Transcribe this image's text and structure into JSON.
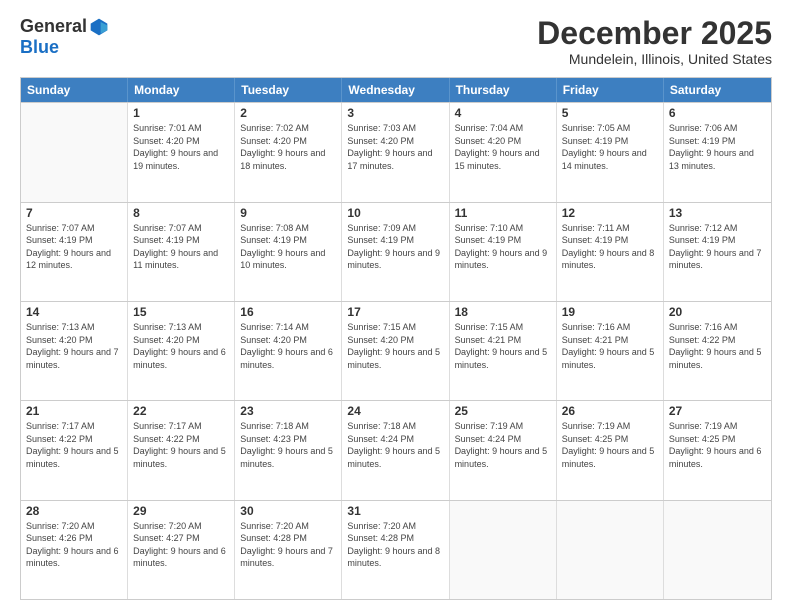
{
  "logo": {
    "general": "General",
    "blue": "Blue"
  },
  "title": "December 2025",
  "location": "Mundelein, Illinois, United States",
  "days": [
    "Sunday",
    "Monday",
    "Tuesday",
    "Wednesday",
    "Thursday",
    "Friday",
    "Saturday"
  ],
  "weeks": [
    [
      {
        "day": "",
        "sunrise": "",
        "sunset": "",
        "daylight": ""
      },
      {
        "day": "1",
        "sunrise": "Sunrise: 7:01 AM",
        "sunset": "Sunset: 4:20 PM",
        "daylight": "Daylight: 9 hours and 19 minutes."
      },
      {
        "day": "2",
        "sunrise": "Sunrise: 7:02 AM",
        "sunset": "Sunset: 4:20 PM",
        "daylight": "Daylight: 9 hours and 18 minutes."
      },
      {
        "day": "3",
        "sunrise": "Sunrise: 7:03 AM",
        "sunset": "Sunset: 4:20 PM",
        "daylight": "Daylight: 9 hours and 17 minutes."
      },
      {
        "day": "4",
        "sunrise": "Sunrise: 7:04 AM",
        "sunset": "Sunset: 4:20 PM",
        "daylight": "Daylight: 9 hours and 15 minutes."
      },
      {
        "day": "5",
        "sunrise": "Sunrise: 7:05 AM",
        "sunset": "Sunset: 4:19 PM",
        "daylight": "Daylight: 9 hours and 14 minutes."
      },
      {
        "day": "6",
        "sunrise": "Sunrise: 7:06 AM",
        "sunset": "Sunset: 4:19 PM",
        "daylight": "Daylight: 9 hours and 13 minutes."
      }
    ],
    [
      {
        "day": "7",
        "sunrise": "Sunrise: 7:07 AM",
        "sunset": "Sunset: 4:19 PM",
        "daylight": "Daylight: 9 hours and 12 minutes."
      },
      {
        "day": "8",
        "sunrise": "Sunrise: 7:07 AM",
        "sunset": "Sunset: 4:19 PM",
        "daylight": "Daylight: 9 hours and 11 minutes."
      },
      {
        "day": "9",
        "sunrise": "Sunrise: 7:08 AM",
        "sunset": "Sunset: 4:19 PM",
        "daylight": "Daylight: 9 hours and 10 minutes."
      },
      {
        "day": "10",
        "sunrise": "Sunrise: 7:09 AM",
        "sunset": "Sunset: 4:19 PM",
        "daylight": "Daylight: 9 hours and 9 minutes."
      },
      {
        "day": "11",
        "sunrise": "Sunrise: 7:10 AM",
        "sunset": "Sunset: 4:19 PM",
        "daylight": "Daylight: 9 hours and 9 minutes."
      },
      {
        "day": "12",
        "sunrise": "Sunrise: 7:11 AM",
        "sunset": "Sunset: 4:19 PM",
        "daylight": "Daylight: 9 hours and 8 minutes."
      },
      {
        "day": "13",
        "sunrise": "Sunrise: 7:12 AM",
        "sunset": "Sunset: 4:19 PM",
        "daylight": "Daylight: 9 hours and 7 minutes."
      }
    ],
    [
      {
        "day": "14",
        "sunrise": "Sunrise: 7:13 AM",
        "sunset": "Sunset: 4:20 PM",
        "daylight": "Daylight: 9 hours and 7 minutes."
      },
      {
        "day": "15",
        "sunrise": "Sunrise: 7:13 AM",
        "sunset": "Sunset: 4:20 PM",
        "daylight": "Daylight: 9 hours and 6 minutes."
      },
      {
        "day": "16",
        "sunrise": "Sunrise: 7:14 AM",
        "sunset": "Sunset: 4:20 PM",
        "daylight": "Daylight: 9 hours and 6 minutes."
      },
      {
        "day": "17",
        "sunrise": "Sunrise: 7:15 AM",
        "sunset": "Sunset: 4:20 PM",
        "daylight": "Daylight: 9 hours and 5 minutes."
      },
      {
        "day": "18",
        "sunrise": "Sunrise: 7:15 AM",
        "sunset": "Sunset: 4:21 PM",
        "daylight": "Daylight: 9 hours and 5 minutes."
      },
      {
        "day": "19",
        "sunrise": "Sunrise: 7:16 AM",
        "sunset": "Sunset: 4:21 PM",
        "daylight": "Daylight: 9 hours and 5 minutes."
      },
      {
        "day": "20",
        "sunrise": "Sunrise: 7:16 AM",
        "sunset": "Sunset: 4:22 PM",
        "daylight": "Daylight: 9 hours and 5 minutes."
      }
    ],
    [
      {
        "day": "21",
        "sunrise": "Sunrise: 7:17 AM",
        "sunset": "Sunset: 4:22 PM",
        "daylight": "Daylight: 9 hours and 5 minutes."
      },
      {
        "day": "22",
        "sunrise": "Sunrise: 7:17 AM",
        "sunset": "Sunset: 4:22 PM",
        "daylight": "Daylight: 9 hours and 5 minutes."
      },
      {
        "day": "23",
        "sunrise": "Sunrise: 7:18 AM",
        "sunset": "Sunset: 4:23 PM",
        "daylight": "Daylight: 9 hours and 5 minutes."
      },
      {
        "day": "24",
        "sunrise": "Sunrise: 7:18 AM",
        "sunset": "Sunset: 4:24 PM",
        "daylight": "Daylight: 9 hours and 5 minutes."
      },
      {
        "day": "25",
        "sunrise": "Sunrise: 7:19 AM",
        "sunset": "Sunset: 4:24 PM",
        "daylight": "Daylight: 9 hours and 5 minutes."
      },
      {
        "day": "26",
        "sunrise": "Sunrise: 7:19 AM",
        "sunset": "Sunset: 4:25 PM",
        "daylight": "Daylight: 9 hours and 5 minutes."
      },
      {
        "day": "27",
        "sunrise": "Sunrise: 7:19 AM",
        "sunset": "Sunset: 4:25 PM",
        "daylight": "Daylight: 9 hours and 6 minutes."
      }
    ],
    [
      {
        "day": "28",
        "sunrise": "Sunrise: 7:20 AM",
        "sunset": "Sunset: 4:26 PM",
        "daylight": "Daylight: 9 hours and 6 minutes."
      },
      {
        "day": "29",
        "sunrise": "Sunrise: 7:20 AM",
        "sunset": "Sunset: 4:27 PM",
        "daylight": "Daylight: 9 hours and 6 minutes."
      },
      {
        "day": "30",
        "sunrise": "Sunrise: 7:20 AM",
        "sunset": "Sunset: 4:28 PM",
        "daylight": "Daylight: 9 hours and 7 minutes."
      },
      {
        "day": "31",
        "sunrise": "Sunrise: 7:20 AM",
        "sunset": "Sunset: 4:28 PM",
        "daylight": "Daylight: 9 hours and 8 minutes."
      },
      {
        "day": "",
        "sunrise": "",
        "sunset": "",
        "daylight": ""
      },
      {
        "day": "",
        "sunrise": "",
        "sunset": "",
        "daylight": ""
      },
      {
        "day": "",
        "sunrise": "",
        "sunset": "",
        "daylight": ""
      }
    ]
  ]
}
